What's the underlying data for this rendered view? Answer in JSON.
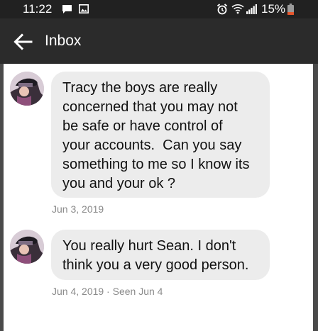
{
  "status_bar": {
    "time": "11:22",
    "battery": "15%",
    "icons": [
      "message-icon",
      "image-icon",
      "alarm-icon",
      "wifi-icon",
      "signal-icon",
      "battery-icon"
    ]
  },
  "app_bar": {
    "title": "Inbox",
    "back_icon": "arrow-left-icon"
  },
  "colors": {
    "status_bar_bg": "#212121",
    "app_bar_bg": "#2b2b2b",
    "bubble_bg": "#ececec",
    "battery_low": "#e4572e"
  },
  "messages": [
    {
      "lines": [
        "Tracy the boys are really",
        "concerned that you may not",
        "be safe or have control of",
        "your accounts.  Can you say",
        "something to me so I know its",
        "you and your ok ?"
      ],
      "meta": "Jun 3, 2019"
    },
    {
      "lines": [
        "You really hurt Sean. I don't",
        "think you a very good person."
      ],
      "meta": "Jun 4, 2019 · Seen Jun 4"
    }
  ]
}
